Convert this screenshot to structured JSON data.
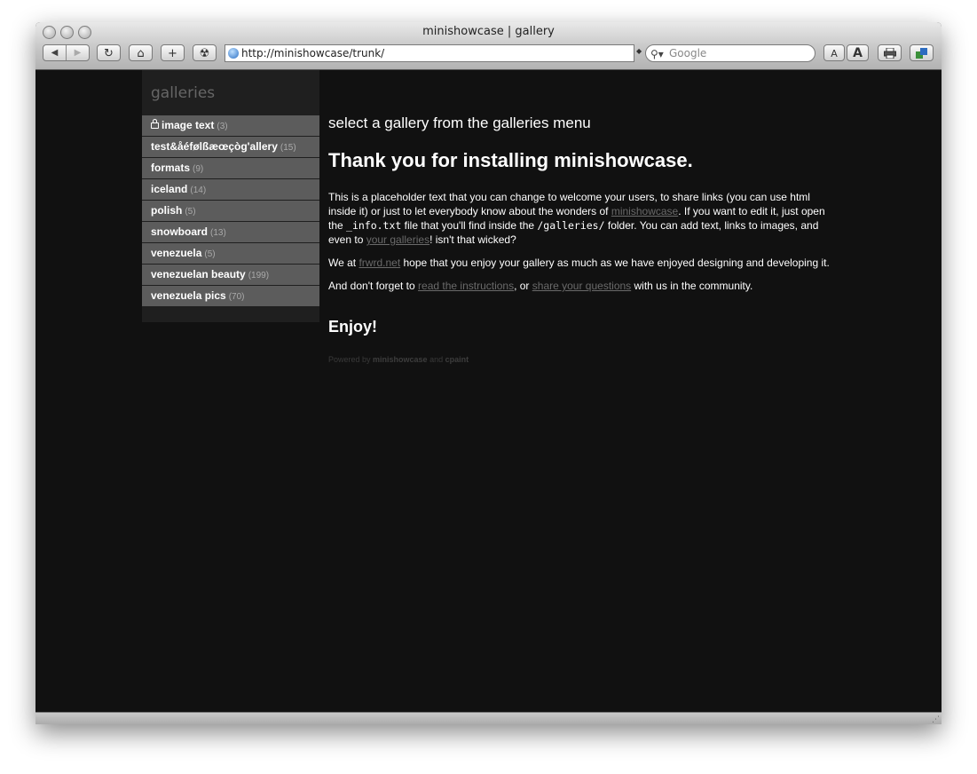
{
  "window": {
    "title": "minishowcase | gallery"
  },
  "toolbar": {
    "back_icon": "◀",
    "forward_icon": "▶",
    "reload_icon": "↻",
    "home_icon": "⌂",
    "add_icon": "+",
    "radiation_icon": "☢",
    "url": "http://minishowcase/trunk/",
    "search_placeholder": "Google",
    "text_smaller_label": "A",
    "text_bigger_label": "A"
  },
  "sidebar": {
    "title": "galleries",
    "items": [
      {
        "label": "image text",
        "count": "(3)",
        "locked": true
      },
      {
        "label": "test&åéfølßæœçòg'allery",
        "count": "(15)"
      },
      {
        "label": "formats",
        "count": "(9)"
      },
      {
        "label": "iceland",
        "count": "(14)"
      },
      {
        "label": "polish",
        "count": "(5)"
      },
      {
        "label": "snowboard",
        "count": "(13)"
      },
      {
        "label": "venezuela",
        "count": "(5)"
      },
      {
        "label": "venezuelan beauty",
        "count": "(199)"
      },
      {
        "label": "venezuela pics",
        "count": "(70)"
      }
    ]
  },
  "main": {
    "subheading": "select a gallery from the galleries menu",
    "heading": "Thank you for installing minishowcase.",
    "p1": {
      "t1": "This is a placeholder text that you can change to welcome your users, to share links (you can use html inside it) or just to let everybody know about the wonders of ",
      "link1": "minishowcase",
      "t2": ". If you want to edit it, just open the ",
      "code1": "_info.txt",
      "t3": " file that you'll find inside the ",
      "code2": "/galleries/",
      "t4": " folder. You can add text, links to images, and even to ",
      "link2": "your galleries",
      "t5": "! isn't that wicked?"
    },
    "p2": {
      "t1": "We at ",
      "link1": "frwrd.net",
      "t2": " hope that you enjoy your gallery as much as we have enjoyed designing and developing it."
    },
    "p3": {
      "t1": "And don't forget to ",
      "link1": "read the instructions",
      "t2": ", or ",
      "link2": "share your questions",
      "t3": " with us in the community."
    },
    "enjoy": "Enjoy!",
    "powered": {
      "t1": "Powered by ",
      "b1": "minishowcase",
      "t2": " and ",
      "b2": "cpaint"
    }
  }
}
